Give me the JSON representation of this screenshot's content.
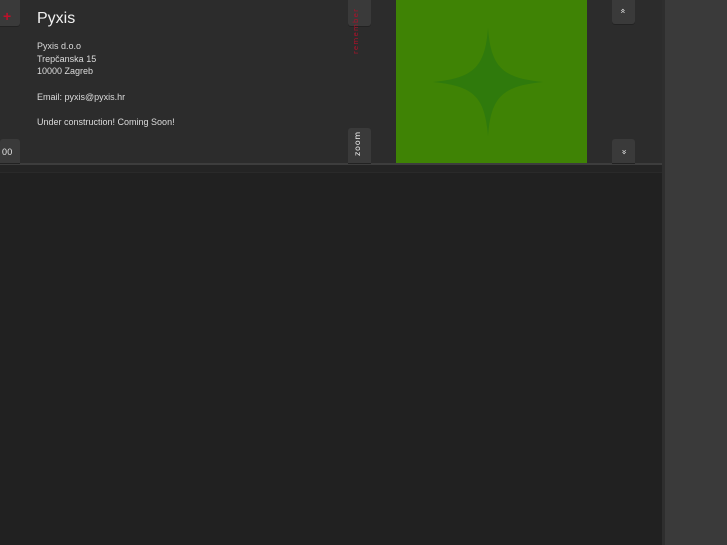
{
  "window": {
    "title": "Pyxis"
  },
  "company": {
    "name": "Pyxis d.o.o",
    "street": "Trepčanska 15",
    "city": "10000 Zagreb",
    "email_line": "Email: pyxis@pyxis.hr",
    "status": "Under construction! Coming Soon!"
  },
  "controls": {
    "add_symbol": "+",
    "count_label": "00",
    "remember_label": "remember",
    "zoom_label": "zoom",
    "scroll_up_symbol": "»",
    "scroll_down_symbol": "»"
  },
  "colors": {
    "accent_red": "#c0102a",
    "preview_green": "#3f8305",
    "star_green": "#2f7a0c"
  },
  "icons": {
    "add": "plus-icon",
    "preview_star": "four-point-star-icon",
    "scroll_up": "double-chevron-up-icon",
    "scroll_down": "double-chevron-down-icon"
  }
}
